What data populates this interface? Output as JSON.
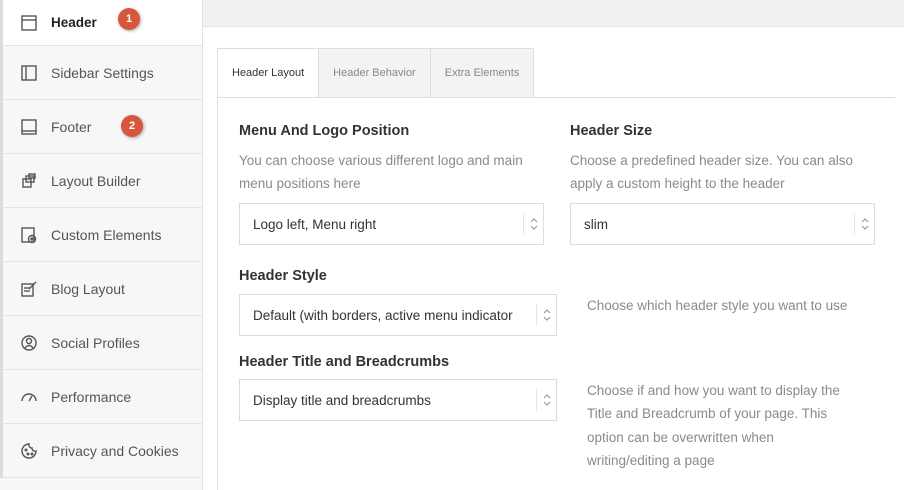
{
  "sidebar": {
    "items": [
      {
        "label": "Header",
        "icon": "header-layout-icon",
        "active": true,
        "badge": "1"
      },
      {
        "label": "Sidebar Settings",
        "icon": "sidebar-layout-icon"
      },
      {
        "label": "Footer",
        "icon": "footer-layout-icon",
        "badge": "2"
      },
      {
        "label": "Layout Builder",
        "icon": "layout-builder-icon"
      },
      {
        "label": "Custom Elements",
        "icon": "custom-elements-icon"
      },
      {
        "label": "Blog Layout",
        "icon": "blog-edit-icon"
      },
      {
        "label": "Social Profiles",
        "icon": "social-profile-icon"
      },
      {
        "label": "Performance",
        "icon": "performance-gauge-icon"
      },
      {
        "label": "Privacy and Cookies",
        "icon": "cookie-icon"
      }
    ]
  },
  "tabs": [
    {
      "label": "Header Layout",
      "active": true
    },
    {
      "label": "Header Behavior"
    },
    {
      "label": "Extra Elements"
    }
  ],
  "fields": {
    "menu_logo": {
      "title": "Menu And Logo Position",
      "desc_line1": "You can choose various different logo and main",
      "desc_line2": "menu positions here",
      "value": "Logo left, Menu right"
    },
    "header_size": {
      "title": "Header Size",
      "desc_line1": "Choose a predefined header size. You can also",
      "desc_line2": "apply a custom height to the header",
      "value": "slim"
    },
    "header_style": {
      "title": "Header Style",
      "value": "Default (with borders, active menu indicator",
      "desc": "Choose which header style you want to use"
    },
    "header_title": {
      "title": "Header Title and Breadcrumbs",
      "value": "Display title and breadcrumbs",
      "desc_line1": "Choose if and how you want to display the",
      "desc_line2": "Title and Breadcrumb of your page. This",
      "desc_line3": "option can be overwritten when",
      "desc_line4": "writing/editing a page"
    }
  },
  "colors": {
    "badge": "#d7573d",
    "sidebar_bg": "#f7f7f7",
    "panel_bg": "#ffffff"
  }
}
